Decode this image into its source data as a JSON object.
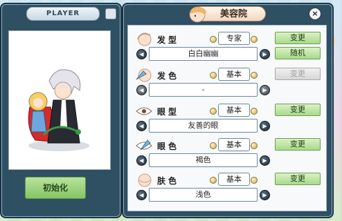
{
  "player": {
    "title": "PLAYER",
    "init_label": "初始化"
  },
  "beauty": {
    "title": "美容院",
    "close_label": "×",
    "rows": [
      {
        "label": "发型",
        "grade": "专家",
        "value": "白白幽幽",
        "change_label": "变更",
        "change_enabled": true,
        "random_label": "随机"
      },
      {
        "label": "发色",
        "grade": "基本",
        "value": "-",
        "change_label": "变更",
        "change_enabled": false
      },
      {
        "label": "眼型",
        "grade": "基本",
        "value": "友善的眼",
        "change_label": "变更",
        "change_enabled": true
      },
      {
        "label": "眼色",
        "grade": "基本",
        "value": "褐色",
        "change_label": "变更",
        "change_enabled": true
      },
      {
        "label": "肤色",
        "grade": "基本",
        "value": "浅色",
        "change_label": "变更",
        "change_enabled": true
      }
    ]
  }
}
